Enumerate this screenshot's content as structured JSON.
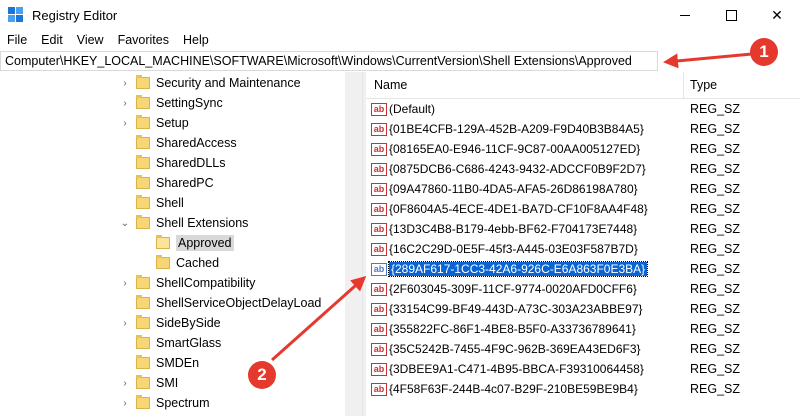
{
  "window": {
    "title": "Registry Editor",
    "minimize_glyph": "—",
    "maximize_glyph": "☐",
    "close_glyph": "✕"
  },
  "menu": [
    "File",
    "Edit",
    "View",
    "Favorites",
    "Help"
  ],
  "address": "Computer\\HKEY_LOCAL_MACHINE\\SOFTWARE\\Microsoft\\Windows\\CurrentVersion\\Shell Extensions\\Approved",
  "tree": [
    {
      "label": "Security and Maintenance",
      "depth": 0,
      "expander": "›",
      "open": false,
      "selected": false
    },
    {
      "label": "SettingSync",
      "depth": 0,
      "expander": "›",
      "open": false,
      "selected": false
    },
    {
      "label": "Setup",
      "depth": 0,
      "expander": "›",
      "open": false,
      "selected": false
    },
    {
      "label": "SharedAccess",
      "depth": 0,
      "expander": "",
      "open": false,
      "selected": false
    },
    {
      "label": "SharedDLLs",
      "depth": 0,
      "expander": "",
      "open": false,
      "selected": false
    },
    {
      "label": "SharedPC",
      "depth": 0,
      "expander": "",
      "open": false,
      "selected": false
    },
    {
      "label": "Shell",
      "depth": 0,
      "expander": "",
      "open": false,
      "selected": false
    },
    {
      "label": "Shell Extensions",
      "depth": 0,
      "expander": "⌄",
      "open": false,
      "selected": false
    },
    {
      "label": "Approved",
      "depth": 1,
      "expander": "",
      "open": true,
      "selected": true
    },
    {
      "label": "Cached",
      "depth": 1,
      "expander": "",
      "open": false,
      "selected": false
    },
    {
      "label": "ShellCompatibility",
      "depth": 0,
      "expander": "›",
      "open": false,
      "selected": false
    },
    {
      "label": "ShellServiceObjectDelayLoad",
      "depth": 0,
      "expander": "",
      "open": false,
      "selected": false
    },
    {
      "label": "SideBySide",
      "depth": 0,
      "expander": "›",
      "open": false,
      "selected": false
    },
    {
      "label": "SmartGlass",
      "depth": 0,
      "expander": "",
      "open": false,
      "selected": false
    },
    {
      "label": "SMDEn",
      "depth": 0,
      "expander": "",
      "open": false,
      "selected": false
    },
    {
      "label": "SMI",
      "depth": 0,
      "expander": "›",
      "open": false,
      "selected": false
    },
    {
      "label": "Spectrum",
      "depth": 0,
      "expander": "›",
      "open": false,
      "selected": false
    }
  ],
  "list": {
    "headers": {
      "name": "Name",
      "type": "Type"
    },
    "icon_text": "ab",
    "rows": [
      {
        "name": "(Default)",
        "type": "REG_SZ",
        "selected": false
      },
      {
        "name": "{01BE4CFB-129A-452B-A209-F9D40B3B84A5}",
        "type": "REG_SZ",
        "selected": false
      },
      {
        "name": "{08165EA0-E946-11CF-9C87-00AA005127ED}",
        "type": "REG_SZ",
        "selected": false
      },
      {
        "name": "{0875DCB6-C686-4243-9432-ADCCF0B9F2D7}",
        "type": "REG_SZ",
        "selected": false
      },
      {
        "name": "{09A47860-11B0-4DA5-AFA5-26D86198A780}",
        "type": "REG_SZ",
        "selected": false
      },
      {
        "name": "{0F8604A5-4ECE-4DE1-BA7D-CF10F8AA4F48}",
        "type": "REG_SZ",
        "selected": false
      },
      {
        "name": "{13D3C4B8-B179-4ebb-BF62-F704173E7448}",
        "type": "REG_SZ",
        "selected": false
      },
      {
        "name": "{16C2C29D-0E5F-45f3-A445-03E03F587B7D}",
        "type": "REG_SZ",
        "selected": false
      },
      {
        "name": "{289AF617-1CC3-42A6-926C-E6A863F0E3BA}",
        "type": "REG_SZ",
        "selected": true
      },
      {
        "name": "{2F603045-309F-11CF-9774-0020AFD0CFF6}",
        "type": "REG_SZ",
        "selected": false
      },
      {
        "name": "{33154C99-BF49-443D-A73C-303A23ABBE97}",
        "type": "REG_SZ",
        "selected": false
      },
      {
        "name": "{355822FC-86F1-4BE8-B5F0-A33736789641}",
        "type": "REG_SZ",
        "selected": false
      },
      {
        "name": "{35C5242B-7455-4F9C-962B-369EA43ED6F3}",
        "type": "REG_SZ",
        "selected": false
      },
      {
        "name": "{3DBEE9A1-C471-4B95-BBCA-F39310064458}",
        "type": "REG_SZ",
        "selected": false
      },
      {
        "name": "{4F58F63F-244B-4c07-B29F-210BE59BE9B4}",
        "type": "REG_SZ",
        "selected": false
      }
    ]
  },
  "annotations": [
    {
      "label": "1",
      "color": "#e5392d"
    },
    {
      "label": "2",
      "color": "#e5392d"
    }
  ]
}
